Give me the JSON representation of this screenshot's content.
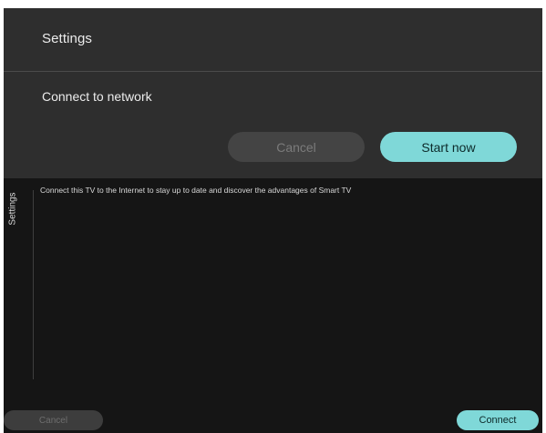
{
  "dialog": {
    "title": "Settings",
    "body": "Connect to network",
    "cancel_label": "Cancel",
    "start_label": "Start now"
  },
  "side": {
    "label": "Settings"
  },
  "info": {
    "text": "Connect this TV to the Internet to stay up to date and discover the advantages of Smart TV"
  },
  "bottom": {
    "cancel_label": "Cancel",
    "connect_label": "Connect"
  },
  "colors": {
    "accent": "#7fd8d8",
    "background": "#151515",
    "dialog": "#2e2e2e"
  }
}
